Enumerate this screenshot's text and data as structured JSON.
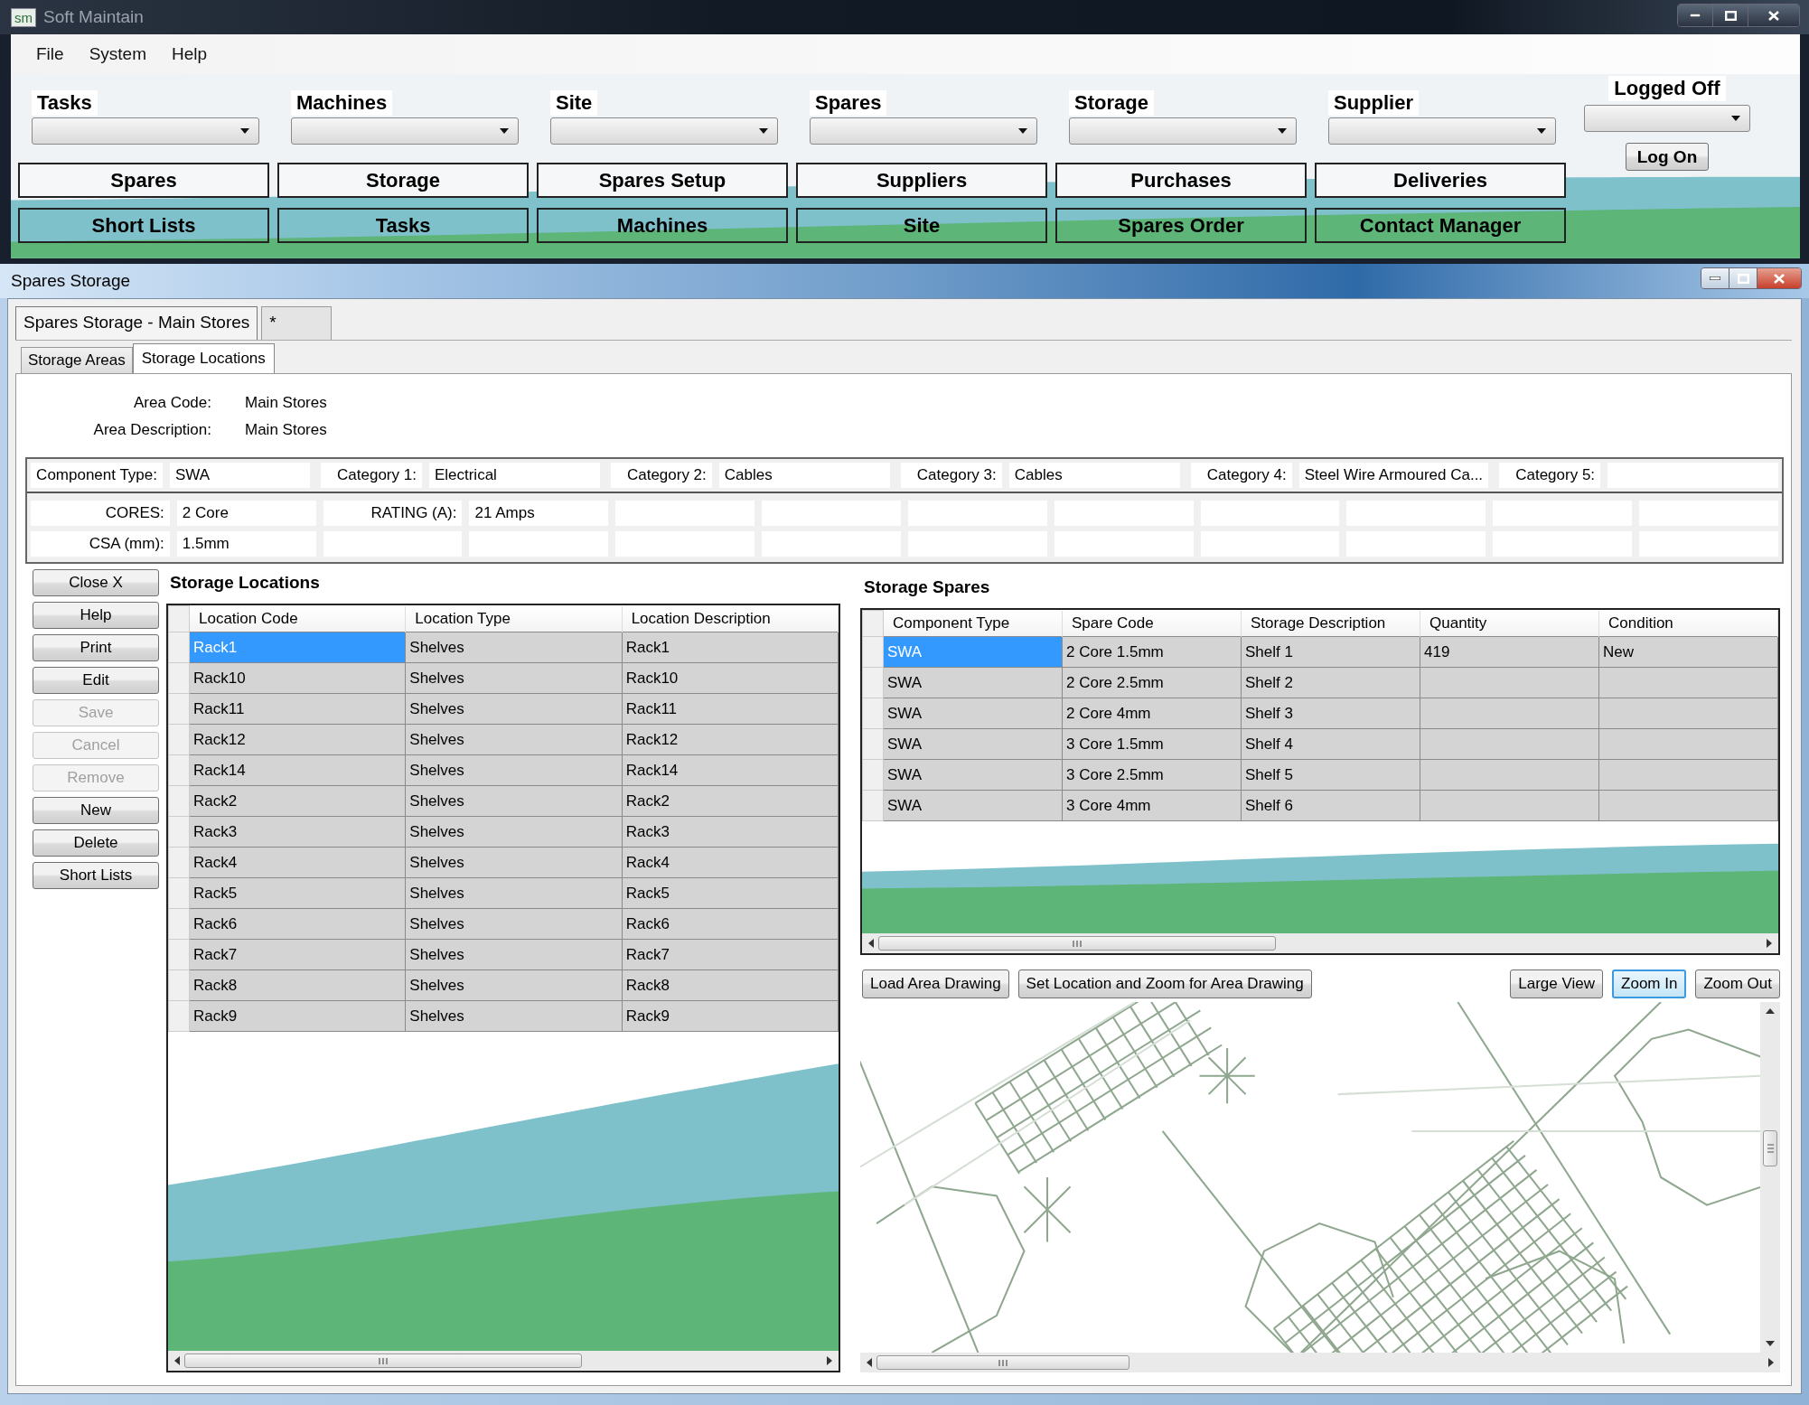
{
  "main_window": {
    "app_icon": "sm",
    "title": "Soft Maintain"
  },
  "menu": [
    "File",
    "System",
    "Help"
  ],
  "dropdowns": [
    {
      "label": "Tasks"
    },
    {
      "label": "Machines"
    },
    {
      "label": "Site"
    },
    {
      "label": "Spares"
    },
    {
      "label": "Storage"
    },
    {
      "label": "Supplier"
    }
  ],
  "login": {
    "status": "Logged Off",
    "button": "Log On"
  },
  "nav_buttons": [
    [
      "Spares",
      "Storage",
      "Spares Setup",
      "Suppliers",
      "Purchases",
      "Deliveries"
    ],
    [
      "Short Lists",
      "Tasks",
      "Machines",
      "Site",
      "Spares Order",
      "Contact Manager"
    ]
  ],
  "child_window": {
    "title": "Spares Storage"
  },
  "document_tabs": [
    {
      "label": "Spares Storage - Main Stores",
      "selected": true
    },
    {
      "label": "*",
      "selected": false
    }
  ],
  "tabs": [
    {
      "label": "Storage Areas",
      "selected": false
    },
    {
      "label": "Storage Locations",
      "selected": true
    }
  ],
  "area_fields": [
    {
      "label": "Area Code:",
      "value": "Main Stores"
    },
    {
      "label": "Area Description:",
      "value": "Main Stores"
    }
  ],
  "categories": [
    {
      "label": "Component Type:",
      "value": "SWA"
    },
    {
      "label": "Category 1:",
      "value": "Electrical"
    },
    {
      "label": "Category 2:",
      "value": "Cables"
    },
    {
      "label": "Category 3:",
      "value": "Cables"
    },
    {
      "label": "Category 4:",
      "value": "Steel Wire Armoured Ca..."
    },
    {
      "label": "Category 5:"
    }
  ],
  "attributes": [
    [
      {
        "label": "CORES:",
        "value": "2 Core"
      },
      {
        "label": "RATING (A):",
        "value": "21 Amps"
      }
    ],
    [
      {
        "label": "CSA (mm):",
        "value": "1.5mm"
      }
    ]
  ],
  "side_buttons": [
    {
      "label": "Close X",
      "disabled": false
    },
    {
      "label": "Help",
      "disabled": false
    },
    {
      "label": "Print",
      "disabled": false
    },
    {
      "label": "Edit",
      "disabled": false
    },
    {
      "label": "Save",
      "disabled": true
    },
    {
      "label": "Cancel",
      "disabled": true
    },
    {
      "label": "Remove",
      "disabled": true
    },
    {
      "label": "New",
      "disabled": false
    },
    {
      "label": "Delete",
      "disabled": false
    },
    {
      "label": "Short Lists",
      "disabled": false
    }
  ],
  "storage_locations": {
    "title": "Storage Locations",
    "columns": [
      "Location Code",
      "Location Type",
      "Location Description"
    ],
    "rows": [
      {
        "cells": [
          "Rack1",
          "Shelves",
          "Rack1"
        ],
        "selected": true
      },
      {
        "cells": [
          "Rack10",
          "Shelves",
          "Rack10"
        ],
        "selected": false
      },
      {
        "cells": [
          "Rack11",
          "Shelves",
          "Rack11"
        ],
        "selected": false
      },
      {
        "cells": [
          "Rack12",
          "Shelves",
          "Rack12"
        ],
        "selected": false
      },
      {
        "cells": [
          "Rack14",
          "Shelves",
          "Rack14"
        ],
        "selected": false
      },
      {
        "cells": [
          "Rack2",
          "Shelves",
          "Rack2"
        ],
        "selected": false
      },
      {
        "cells": [
          "Rack3",
          "Shelves",
          "Rack3"
        ],
        "selected": false
      },
      {
        "cells": [
          "Rack4",
          "Shelves",
          "Rack4"
        ],
        "selected": false
      },
      {
        "cells": [
          "Rack5",
          "Shelves",
          "Rack5"
        ],
        "selected": false
      },
      {
        "cells": [
          "Rack6",
          "Shelves",
          "Rack6"
        ],
        "selected": false
      },
      {
        "cells": [
          "Rack7",
          "Shelves",
          "Rack7"
        ],
        "selected": false
      },
      {
        "cells": [
          "Rack8",
          "Shelves",
          "Rack8"
        ],
        "selected": false
      },
      {
        "cells": [
          "Rack9",
          "Shelves",
          "Rack9"
        ],
        "selected": false
      }
    ]
  },
  "storage_spares": {
    "title": "Storage Spares",
    "columns": [
      "Component Type",
      "Spare Code",
      "Storage Description",
      "Quantity",
      "Condition"
    ],
    "rows": [
      {
        "cells": [
          "SWA",
          "2 Core 1.5mm",
          "Shelf 1",
          "419",
          "New"
        ],
        "selected": true
      },
      {
        "cells": [
          "SWA",
          "2 Core 2.5mm",
          "Shelf 2"
        ],
        "selected": false
      },
      {
        "cells": [
          "SWA",
          "2 Core 4mm",
          "Shelf 3"
        ],
        "selected": false
      },
      {
        "cells": [
          "SWA",
          "3 Core 1.5mm",
          "Shelf 4"
        ],
        "selected": false
      },
      {
        "cells": [
          "SWA",
          "3 Core 2.5mm",
          "Shelf 5"
        ],
        "selected": false
      },
      {
        "cells": [
          "SWA",
          "3 Core 4mm",
          "Shelf 6"
        ],
        "selected": false
      }
    ]
  },
  "drawing_buttons_left": [
    {
      "label": "Load Area Drawing",
      "focused": false
    },
    {
      "label": "Set Location and Zoom for Area Drawing",
      "focused": false
    }
  ],
  "drawing_buttons_right": [
    {
      "label": "Large View",
      "focused": false
    },
    {
      "label": "Zoom In",
      "focused": true
    },
    {
      "label": "Zoom Out",
      "focused": false
    }
  ]
}
